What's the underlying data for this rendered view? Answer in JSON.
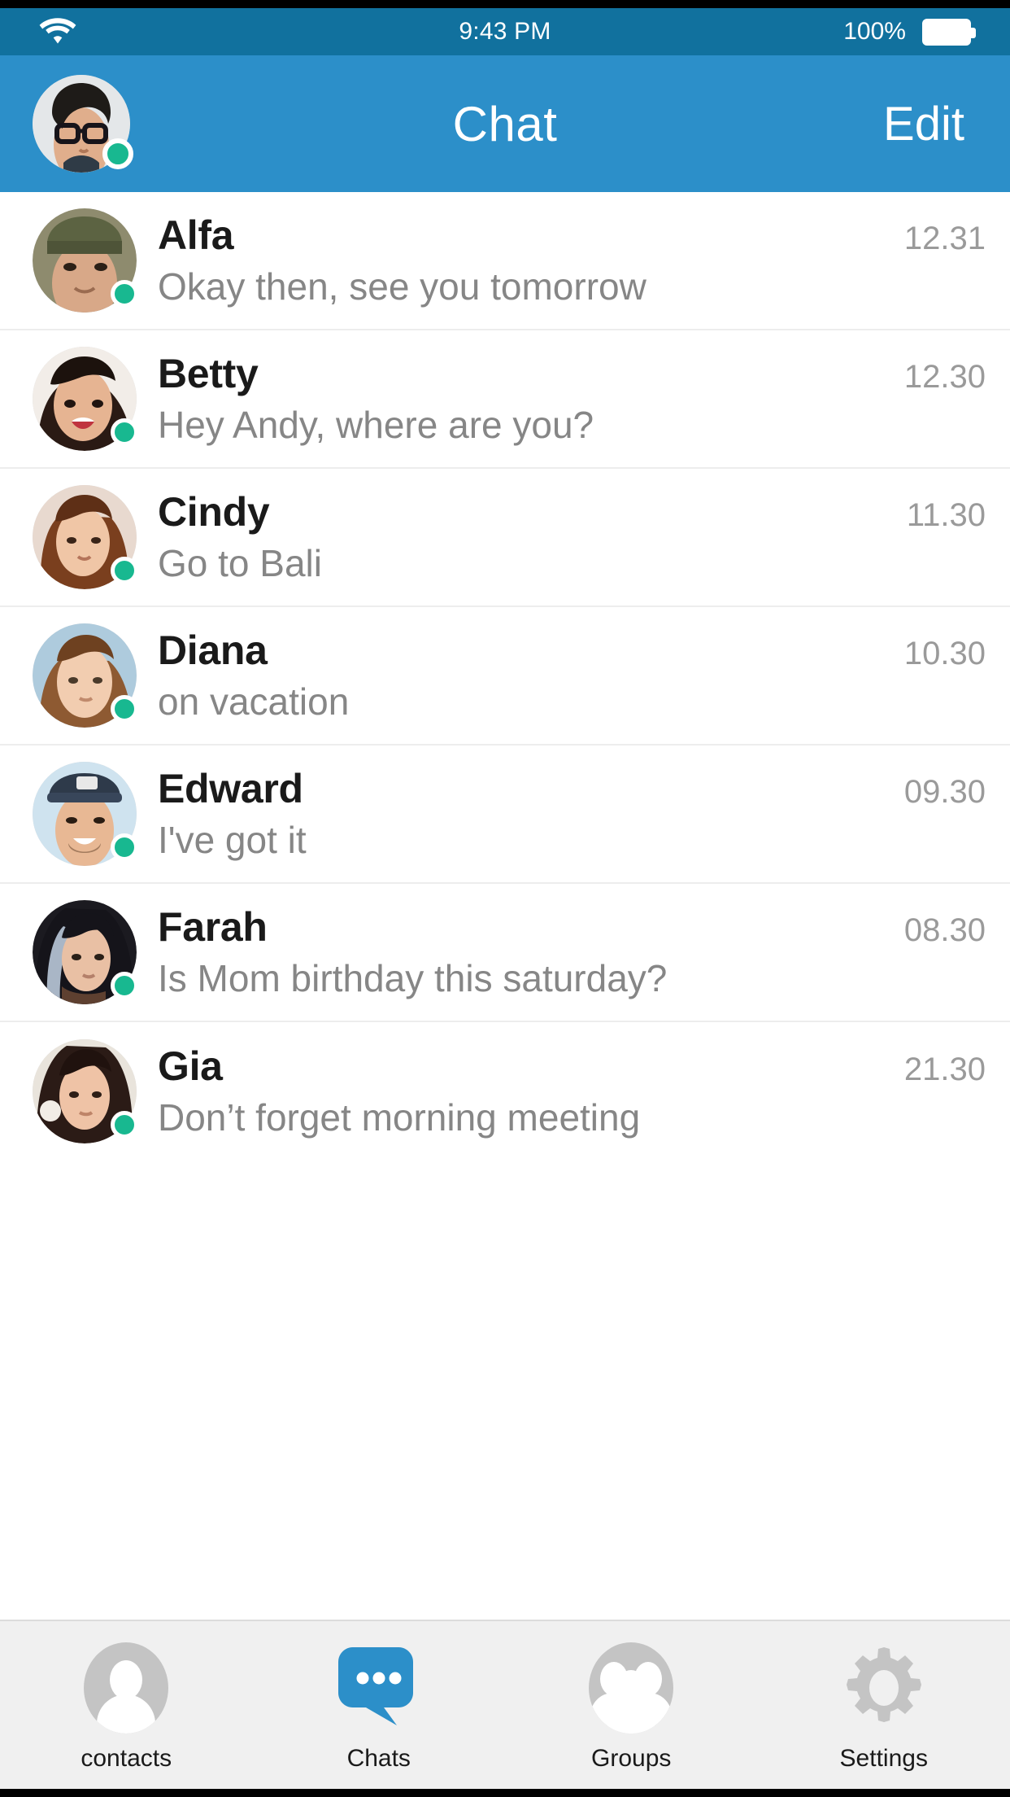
{
  "status_bar": {
    "wifi_icon": "wifi-icon",
    "time": "9:43 PM",
    "battery_percent": "100%",
    "battery_icon": "battery-full-icon",
    "background_color": "#11719E"
  },
  "header": {
    "title": "Chat",
    "edit_label": "Edit",
    "avatar_icon": "user-avatar",
    "online_indicator": "online-dot",
    "background_color": "#2C8FC9",
    "online_color": "#18B890"
  },
  "chats": [
    {
      "name": "Alfa",
      "message": "Okay then, see you tomorrow",
      "time": "12.31",
      "online": true
    },
    {
      "name": "Betty",
      "message": "Hey Andy, where are you?",
      "time": "12.30",
      "online": true
    },
    {
      "name": "Cindy",
      "message": "Go to Bali",
      "time": "11.30",
      "online": true
    },
    {
      "name": "Diana",
      "message": "on vacation",
      "time": "10.30",
      "online": true
    },
    {
      "name": "Edward",
      "message": "I've got it",
      "time": "09.30",
      "online": true
    },
    {
      "name": "Farah",
      "message": "Is Mom birthday this saturday?",
      "time": "08.30",
      "online": true
    },
    {
      "name": "Gia",
      "message": "Don’t forget morning meeting",
      "time": "21.30",
      "online": true
    }
  ],
  "tab_bar": {
    "active_index": 1,
    "active_color": "#2C8FC9",
    "inactive_color": "#C4C4C4",
    "items": [
      {
        "label": "contacts",
        "icon": "contacts-icon"
      },
      {
        "label": "Chats",
        "icon": "chat-bubble-icon"
      },
      {
        "label": "Groups",
        "icon": "groups-icon"
      },
      {
        "label": "Settings",
        "icon": "gear-icon"
      }
    ]
  }
}
